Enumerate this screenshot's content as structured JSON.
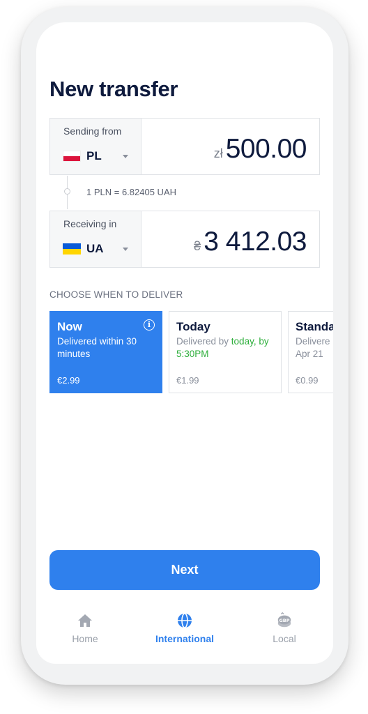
{
  "header": {
    "title": "New transfer"
  },
  "sending": {
    "label": "Sending from",
    "country_code": "PL",
    "currency_symbol": "zł",
    "amount": "500.00"
  },
  "rate": {
    "text": "1 PLN = 6.82405 UAH"
  },
  "receiving": {
    "label": "Receiving in",
    "country_code": "UA",
    "currency_symbol": "₴",
    "amount": "3 412.03"
  },
  "delivery": {
    "heading": "CHOOSE WHEN TO DELIVER",
    "options": [
      {
        "title": "Now",
        "desc": "Delivered within 30 minutes",
        "price": "€2.99",
        "selected": true,
        "info_icon": "info-icon"
      },
      {
        "title": "Today",
        "desc_prefix": "Delivered by ",
        "desc_highlight": "today, by 5:30PM",
        "price": "€1.99",
        "selected": false
      },
      {
        "title": "Standa",
        "desc": "Delivere Apr 21",
        "desc_line1": "Delivere",
        "desc_line2": "Apr 21",
        "price": "€0.99",
        "selected": false
      }
    ]
  },
  "actions": {
    "next_label": "Next"
  },
  "tabbar": {
    "items": [
      {
        "label": "Home",
        "icon": "home-icon",
        "active": false
      },
      {
        "label": "International",
        "icon": "globe-icon",
        "active": true
      },
      {
        "label": "Local",
        "icon": "gbp-coin-icon",
        "active": false
      }
    ]
  },
  "colors": {
    "accent": "#2f80ed",
    "title": "#0e1a3d",
    "highlight_green": "#2cae3a"
  }
}
